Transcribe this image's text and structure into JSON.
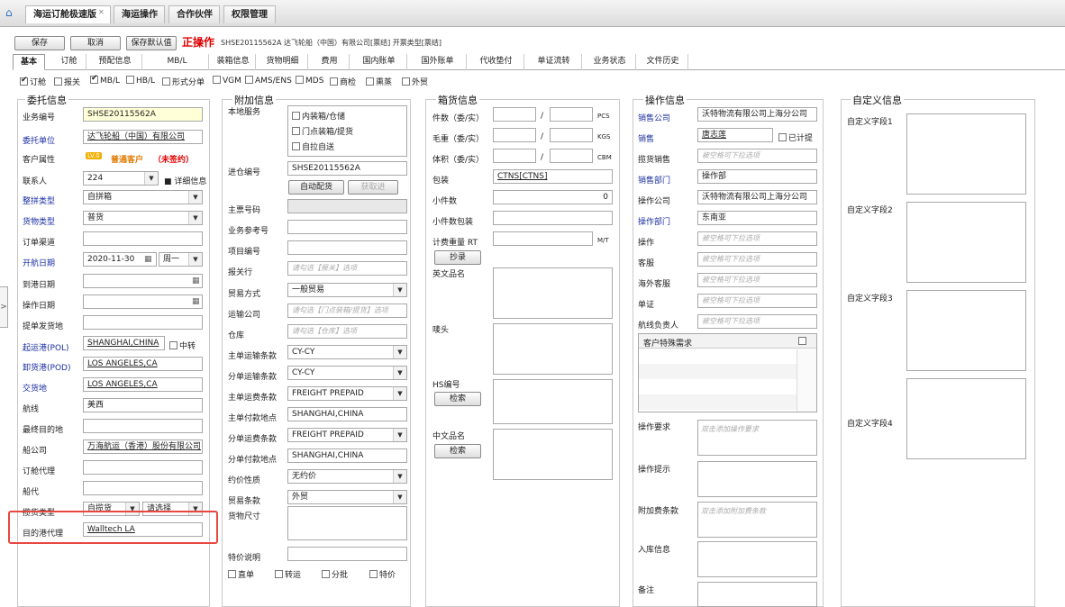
{
  "tabs": [
    {
      "label": "海运订舱极速版",
      "closable": true
    },
    {
      "label": "海运操作"
    },
    {
      "label": "合作伙伴"
    },
    {
      "label": "权限管理"
    }
  ],
  "toolbar": {
    "save": "保存",
    "cancel": "取消",
    "save_default": "保存默认值",
    "op_title": "正操作",
    "op_info": "SHSE20115562A  达飞轮船（中国）有限公司[票结]  开票类型[票结]"
  },
  "subtabs": [
    "基本",
    "订舱",
    "预配信息",
    "MB/L",
    "装箱信息",
    "货物明细",
    "费用",
    "国内账单",
    "国外账单",
    "代收垫付",
    "单证流转",
    "业务状态",
    "文件历史"
  ],
  "checks": [
    {
      "label": "订舱",
      "on": true
    },
    {
      "label": "报关",
      "on": false
    },
    {
      "label": "MB/L",
      "on": true
    },
    {
      "label": "HB/L",
      "on": false
    },
    {
      "label": "形式分单",
      "on": false
    },
    {
      "label": "VGM",
      "on": false
    },
    {
      "label": "AMS/ENS",
      "on": false
    },
    {
      "label": "MDS",
      "on": false
    },
    {
      "label": "商检",
      "on": false
    },
    {
      "label": "熏蒸",
      "on": false
    },
    {
      "label": "外贸",
      "on": false
    }
  ],
  "consign": {
    "title": "委托信息",
    "business_no_label": "业务编号",
    "business_no": "SHSE20115562A",
    "client_label": "委托单位",
    "client": "达飞轮船（中国）有限公司",
    "customer_attr_label": "客户属性",
    "customer_badge": "LV.0",
    "customer_type": "普通客户",
    "customer_contract": "（未签约）",
    "contact_label": "联系人",
    "contact": "224",
    "detail": "详细信息",
    "assemble_label": "整拼类型",
    "assemble": "自拼箱",
    "cargo_type_label": "货物类型",
    "cargo_type": "普货",
    "order_channel_label": "订单渠道",
    "order_channel": "",
    "sail_date_label": "开航日期",
    "sail_date": "2020-11-30",
    "sail_week": "周一",
    "arrive_label": "到港日期",
    "op_date_label": "操作日期",
    "bl_place_label": "提单发货地",
    "pol_label": "起运港(POL)",
    "pol": "SHANGHAI,CHINA",
    "transship": "中转",
    "pod_label": "卸货港(POD)",
    "pod": "LOS ANGELES,CA",
    "delivery_label": "交货地",
    "delivery": "LOS ANGELES,CA",
    "route_label": "航线",
    "route": "美西",
    "final_dest_label": "最终目的地",
    "carrier_label": "船公司",
    "carrier": "万海航运（香港）股份有限公司",
    "booking_agent_label": "订舱代理",
    "ship_agent_label": "船代",
    "solicit_label": "揽货类型",
    "solicit": "自揽货",
    "solicit2": "请选择",
    "dest_agent_label": "目的港代理",
    "dest_agent": "Walltech LA"
  },
  "extra": {
    "title": "附加信息",
    "local_service_label": "本地服务",
    "local_services": [
      "内装箱/仓储",
      "门点装箱/提货",
      "自拉自送"
    ],
    "inbound_label": "进仓编号",
    "inbound": "SHSE20115562A",
    "auto_btn": "自动配货",
    "fetch_btn": "获取进",
    "master_no_label": "主票号码",
    "biz_ref_label": "业务参考号",
    "project_label": "项目编号",
    "broker_label": "报关行",
    "broker_ph": "请勾选【报关】选项",
    "trade_mode_label": "贸易方式",
    "trade_mode": "一般贸易",
    "transport_label": "运输公司",
    "transport_ph": "请勾选【门点装箱/提货】选项",
    "warehouse_label": "仓库",
    "warehouse_ph": "请勾选【仓库】选项",
    "master_clause_label": "主单运输条款",
    "master_clause": "CY-CY",
    "house_clause_label": "分单运输条款",
    "house_clause": "CY-CY",
    "master_freight_label": "主单运费条款",
    "master_freight": "FREIGHT PREPAID",
    "master_pay_label": "主单付款地点",
    "master_pay": "SHANGHAI,CHINA",
    "house_freight_label": "分单运费条款",
    "house_freight": "FREIGHT PREPAID",
    "house_pay_label": "分单付款地点",
    "house_pay": "SHANGHAI,CHINA",
    "price_label": "约价性质",
    "price": "无约价",
    "trade_label": "贸易条款",
    "trade": "外贸",
    "size_label": "货物尺寸",
    "special_label": "特价说明",
    "flags": [
      "直单",
      "转运",
      "分批",
      "特价"
    ]
  },
  "cargo": {
    "title": "箱货信息",
    "pieces_label": "件数（委/实）",
    "pieces_unit": "PCS",
    "gross_label": "毛重（委/实）",
    "gross_unit": "KGS",
    "volume_label": "体积（委/实）",
    "volume_unit": "CBM",
    "pack_label": "包装",
    "pack": "CTNS[CTNS]",
    "small_label": "小件数",
    "small": "0",
    "small_pack_label": "小件数包装",
    "rt_label": "计费重量 RT",
    "rt_unit": "M/T",
    "copy_btn": "抄录",
    "en_name_label": "英文品名",
    "mark_label": "唛头",
    "hs_label": "HS编号",
    "search_btn": "检索",
    "cn_name_label": "中文品名",
    "search_btn2": "检索"
  },
  "op": {
    "title": "操作信息",
    "sales_co_label": "销售公司",
    "sales_co": "沃特物流有限公司上海分公司",
    "sales_label": "销售",
    "sales": "唐志莲",
    "commission": "已计提",
    "solicit_sales_label": "揽货销售",
    "ph": "被空格可下拉选项",
    "sales_dept_label": "销售部门",
    "sales_dept": "操作部",
    "op_co_label": "操作公司",
    "op_co": "沃特物流有限公司上海分公司",
    "op_dept_label": "操作部门",
    "op_dept": "东南亚",
    "operator_label": "操作",
    "cs_label": "客服",
    "overseas_cs_label": "海外客服",
    "doc_label": "单证",
    "route_mgr_label": "航线负责人",
    "special_req_label": "客户特殊需求",
    "op_req_label": "操作要求",
    "op_req_ph": "双击添加操作要求",
    "op_tip_label": "操作提示",
    "extra_fee_label": "附加费条款",
    "extra_fee_ph": "双击添加附加费条款",
    "stock_label": "入库信息",
    "remark_label": "备注"
  },
  "custom": {
    "title": "自定义信息",
    "f1": "自定义字段1",
    "f2": "自定义字段2",
    "f3": "自定义字段3",
    "f4": "自定义字段4"
  }
}
